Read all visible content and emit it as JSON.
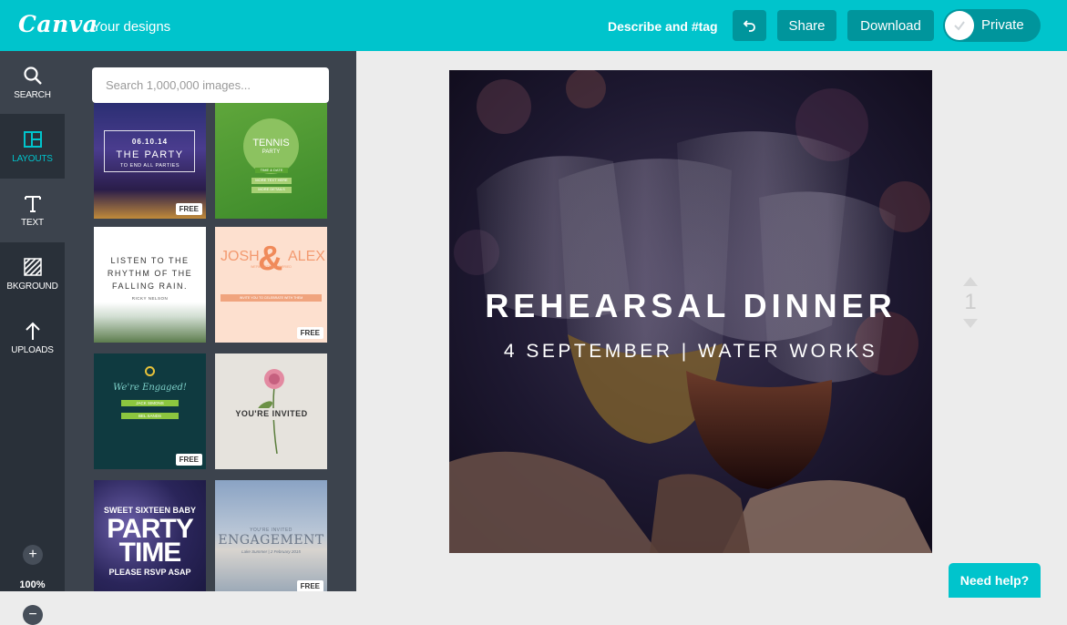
{
  "header": {
    "logo": "Canva",
    "your_designs": "Your designs",
    "describe": "Describe and #tag",
    "share": "Share",
    "download": "Download",
    "private": "Private"
  },
  "sidebar": {
    "items": [
      {
        "label": "SEARCH",
        "icon": "search-icon"
      },
      {
        "label": "LAYOUTS",
        "icon": "layouts-icon"
      },
      {
        "label": "TEXT",
        "icon": "text-icon"
      },
      {
        "label": "BKGROUND",
        "icon": "background-icon"
      },
      {
        "label": "UPLOADS",
        "icon": "upload-icon"
      }
    ],
    "zoom_level": "100%"
  },
  "panel": {
    "search_placeholder": "Search 1,000,000 images...",
    "templates": [
      {
        "lines": [
          "06.10.14",
          "THE PARTY",
          "TO END ALL PARTIES"
        ],
        "free": "FREE"
      },
      {
        "lines": [
          "TENNIS",
          "PARTY",
          "TIME & DATE",
          "MORE TEXT HERE",
          "MORE DETAILS"
        ]
      },
      {
        "lines": [
          "LISTEN TO THE",
          "RHYTHM OF THE",
          "FALLING RAIN.",
          "RICKY NELSON"
        ]
      },
      {
        "lines": [
          "JOSH",
          "&",
          "ALEX",
          "WE'RE GETTING MARRIED",
          "INVITE YOU TO CELEBRATE WITH THEM"
        ],
        "free": "FREE"
      },
      {
        "lines": [
          "We're Engaged!",
          "JACK SIMONS",
          "BEL SANDS"
        ],
        "free": "FREE"
      },
      {
        "lines": [
          "YOU'RE INVITED"
        ]
      },
      {
        "lines": [
          "SWEET SIXTEEN BABY",
          "PARTY",
          "TIME",
          "PLEASE RSVP ASAP"
        ]
      },
      {
        "lines": [
          "YOU'RE INVITED",
          "ENGAGEMENT",
          "Lake Summer | 2 February 2015"
        ],
        "free": "FREE"
      }
    ]
  },
  "design": {
    "title": "REHEARSAL DINNER",
    "subtitle": "4 SEPTEMBER | WATER WORKS"
  },
  "page_nav": {
    "current": "1"
  },
  "help": "Need help?",
  "colors": {
    "accent": "#00c4cc",
    "accent_dark": "#00959c",
    "nav_bg": "#293039",
    "panel_bg": "#3c434d"
  }
}
